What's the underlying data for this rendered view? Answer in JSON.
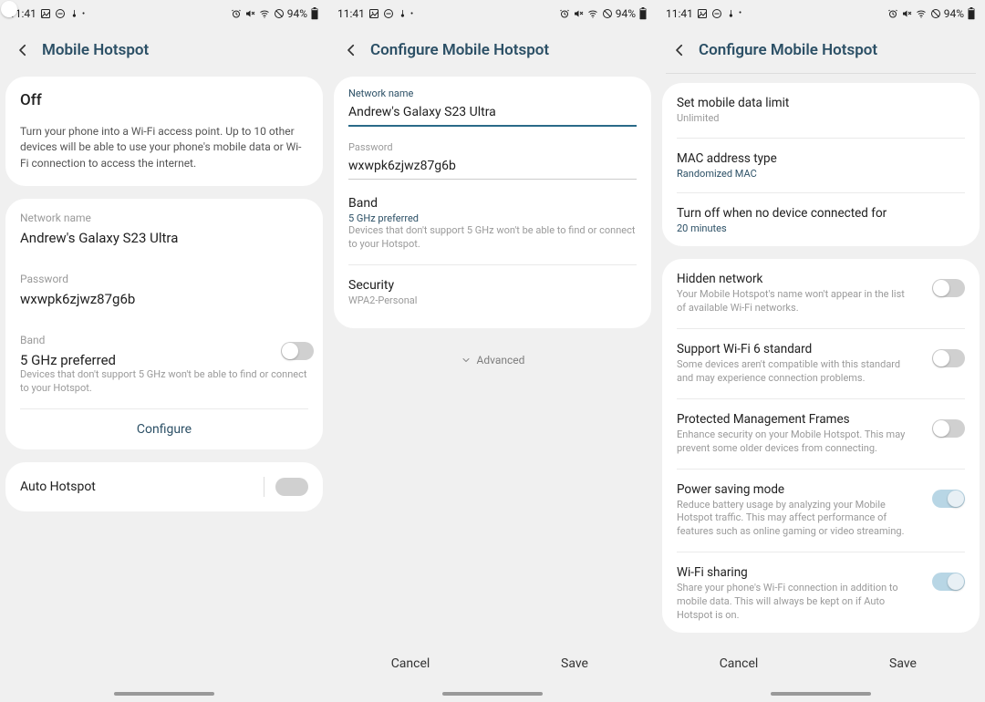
{
  "status": {
    "time": "11:41",
    "battery_pct": "94%",
    "left_icons": [
      "image-icon",
      "minus-circle-icon",
      "thermometer-icon",
      "dot-icon"
    ],
    "right_icons": [
      "alarm-icon",
      "mute-icon",
      "wifi-icon",
      "dnd-icon",
      "battery-icon"
    ]
  },
  "screen1": {
    "title": "Mobile Hotspot",
    "state_label": "Off",
    "state_on": false,
    "state_desc": "Turn your phone into a Wi-Fi access point. Up to 10 other devices will be able to use your phone's mobile data or Wi-Fi connection to access the internet.",
    "network_name_label": "Network name",
    "network_name_value": "Andrew's Galaxy S23 Ultra",
    "password_label": "Password",
    "password_value": "wxwpk6zjwz87g6b",
    "band_label": "Band",
    "band_value": "5 GHz preferred",
    "band_sub": "Devices that don't support 5 GHz won't be able to find or connect to your Hotspot.",
    "configure_label": "Configure",
    "auto_hotspot_label": "Auto Hotspot",
    "auto_hotspot_on": false
  },
  "screen2": {
    "title": "Configure Mobile Hotspot",
    "network_name_label": "Network name",
    "network_name_value": "Andrew's Galaxy S23 Ultra",
    "password_label": "Password",
    "password_value": "wxwpk6zjwz87g6b",
    "band_label": "Band",
    "band_value": "5 GHz preferred",
    "band_sub": "Devices that don't support 5 GHz won't be able to find or connect to your Hotspot.",
    "security_label": "Security",
    "security_value": "WPA2-Personal",
    "advanced_label": "Advanced",
    "cancel_label": "Cancel",
    "save_label": "Save"
  },
  "screen3": {
    "title": "Configure Mobile Hotspot",
    "data_limit_label": "Set mobile data limit",
    "data_limit_value": "Unlimited",
    "mac_label": "MAC address type",
    "mac_value": "Randomized MAC",
    "idle_label": "Turn off when no device connected for",
    "idle_value": "20 minutes",
    "hidden_label": "Hidden network",
    "hidden_sub": "Your Mobile Hotspot's name won't appear in the list of available Wi-Fi networks.",
    "hidden_on": false,
    "wifi6_label": "Support Wi-Fi 6 standard",
    "wifi6_sub": "Some devices aren't compatible with this standard and may experience connection problems.",
    "wifi6_on": false,
    "pmf_label": "Protected Management Frames",
    "pmf_sub": "Enhance security on your Mobile Hotspot. This may prevent some older devices from connecting.",
    "pmf_on": false,
    "psm_label": "Power saving mode",
    "psm_sub": "Reduce battery usage by analyzing your Mobile Hotspot traffic. This may affect performance of features such as online gaming or video streaming.",
    "psm_on": true,
    "wifishare_label": "Wi-Fi sharing",
    "wifishare_sub": "Share your phone's Wi-Fi connection in addition to mobile data. This will always be kept on if Auto Hotspot is on.",
    "wifishare_on": true,
    "cancel_label": "Cancel",
    "save_label": "Save"
  }
}
